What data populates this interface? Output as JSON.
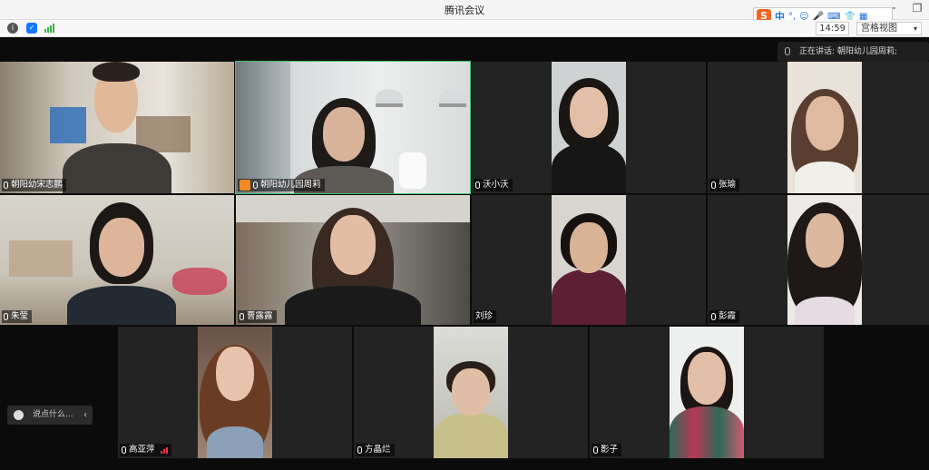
{
  "window": {
    "title": "腾讯会议",
    "minimize": "─",
    "restore": "❐"
  },
  "toolbar": {
    "clock": "14:59",
    "view_mode": "宫格视图"
  },
  "ime": {
    "logo": "S",
    "mode": "中",
    "items": [
      "°,",
      "☺",
      "🎤",
      "⌨",
      "👕",
      "▦"
    ]
  },
  "speaking": {
    "text": "正在讲话: 朝阳幼儿园周莉;"
  },
  "chat": {
    "placeholder": "说点什么..."
  },
  "participants": [
    {
      "name": "朝阳幼宋志鹏"
    },
    {
      "name": "朝阳幼儿园周莉",
      "host": true
    },
    {
      "name": "沃小沃"
    },
    {
      "name": "张瑜"
    },
    {
      "name": "朱莹"
    },
    {
      "name": "曹露露"
    },
    {
      "name": "刘珍"
    },
    {
      "name": "彭霞"
    },
    {
      "name": "高亚萍"
    },
    {
      "name": "方晶烂"
    },
    {
      "name": "影子"
    }
  ]
}
